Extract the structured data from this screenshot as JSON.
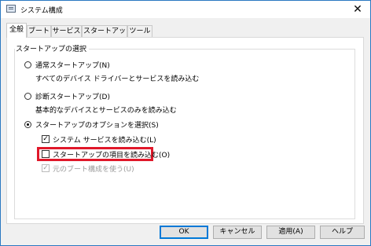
{
  "window": {
    "title": "システム構成",
    "close_glyph": "✕"
  },
  "tabs": [
    {
      "label": "全般",
      "active": true
    },
    {
      "label": "ブート",
      "active": false
    },
    {
      "label": "サービス",
      "active": false
    },
    {
      "label": "スタートアップ",
      "active": false
    },
    {
      "label": "ツール",
      "active": false
    }
  ],
  "startup_selection": {
    "group_title": "スタートアップの選択",
    "normal": {
      "label": "通常スタートアップ(N)",
      "description": "すべてのデバイス ドライバーとサービスを読み込む",
      "selected": false
    },
    "diagnostic": {
      "label": "診断スタートアップ(D)",
      "description": "基本的なデバイスとサービスのみを読み込む",
      "selected": false
    },
    "selective": {
      "label": "スタートアップのオプションを選択(S)",
      "selected": true
    },
    "options": {
      "load_system_services": {
        "label": "システム サービスを読み込む(L)",
        "checked": true,
        "enabled": true
      },
      "load_startup_items": {
        "label": "スタートアップの項目を読み込む(O)",
        "checked": false,
        "enabled": true,
        "highlighted": true
      },
      "use_original_boot_config": {
        "label": "元のブート構成を使う(U)",
        "checked": true,
        "enabled": false
      }
    }
  },
  "buttons": {
    "ok": "OK",
    "cancel": "キャンセル",
    "apply": "適用(A)",
    "help": "ヘルプ"
  },
  "colors": {
    "highlight": "#e0182a",
    "window_border": "#2b79c2",
    "default_button_border": "#0078d7"
  }
}
